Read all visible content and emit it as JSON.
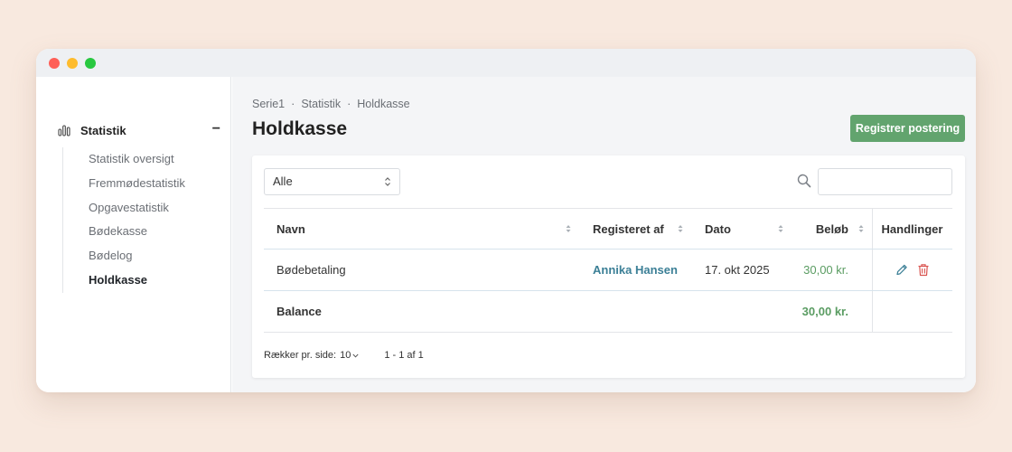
{
  "sidebar": {
    "section_label": "Statistik",
    "collapse_symbol": "−",
    "items": [
      {
        "label": "Statistik oversigt"
      },
      {
        "label": "Fremmødestatistik"
      },
      {
        "label": "Opgavestatistik"
      },
      {
        "label": "Bødekasse"
      },
      {
        "label": "Bødelog"
      },
      {
        "label": "Holdkasse",
        "active": true
      }
    ]
  },
  "breadcrumb": {
    "items": [
      "Serie1",
      "Statistik",
      "Holdkasse"
    ],
    "separator": "·"
  },
  "page": {
    "title": "Holdkasse",
    "primary_button": "Registrer postering"
  },
  "filter": {
    "selected": "Alle"
  },
  "search": {
    "value": "",
    "placeholder": ""
  },
  "table": {
    "columns": [
      "Navn",
      "Registeret af",
      "Dato",
      "Beløb",
      "Handlinger"
    ],
    "rows": [
      {
        "name": "Bødebetaling",
        "registered_by": "Annika Hansen",
        "date": "17. okt 2025",
        "amount": "30,00 kr."
      }
    ],
    "footer": {
      "label": "Balance",
      "amount": "30,00 kr."
    }
  },
  "pagination": {
    "rows_per_page_label": "Rækker pr. side:",
    "rows_per_page": "10",
    "range": "1 - 1 af 1"
  },
  "icons": {
    "section": "bar-chart-icon",
    "search": "search-icon",
    "edit": "pencil-icon",
    "delete": "trash-icon"
  },
  "colors": {
    "accent_green": "#62a46e",
    "amount_green": "#5a9c62",
    "link_blue": "#3b7f96",
    "delete_red": "#d9534f",
    "background": "#f8e9df"
  }
}
